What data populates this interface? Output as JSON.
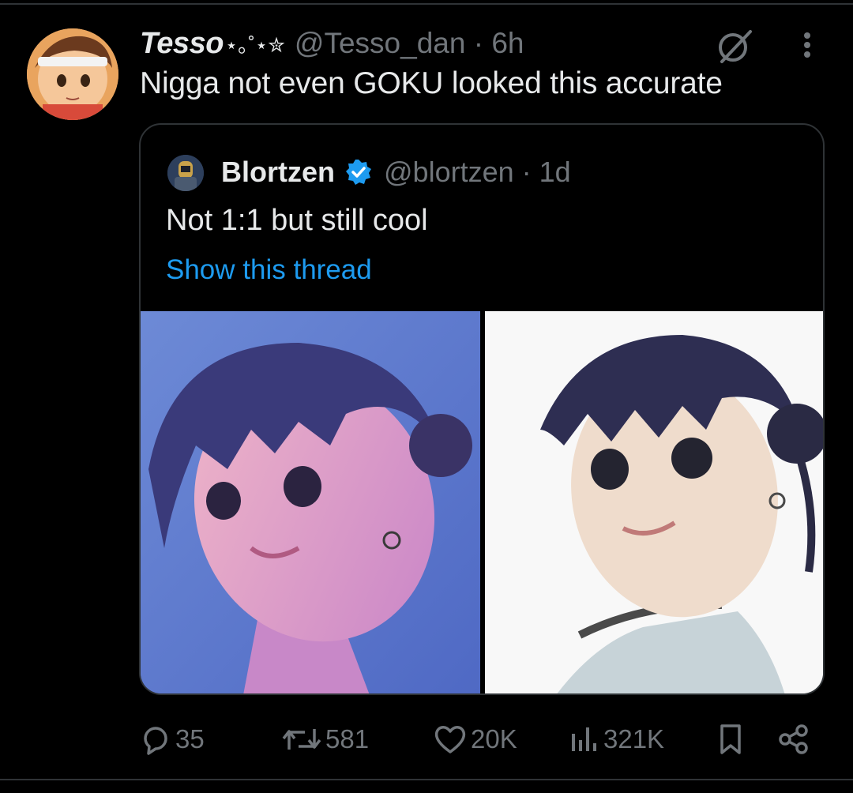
{
  "tweet": {
    "display_name": "Tesso",
    "name_decoration": "⋆｡˚⋆✮",
    "handle_time": "@Tesso_dan · 6h",
    "text": "Nigga not even GOKU looked this accurate"
  },
  "quote": {
    "display_name": "Blortzen",
    "handle_time": "@blortzen · 1d",
    "text": "Not 1:1 but still cool",
    "link": "Show this thread"
  },
  "actions": {
    "replies": "35",
    "reposts": "581",
    "likes": "20K",
    "views": "321K"
  },
  "icons": [
    "grok-icon",
    "more-icon",
    "verified-badge-icon",
    "reply-icon",
    "repost-icon",
    "like-icon",
    "views-icon",
    "bookmark-icon",
    "share-icon"
  ],
  "colors": {
    "background": "#000000",
    "text": "#e7e9ea",
    "muted": "#71767b",
    "link": "#1d9bf0",
    "border": "#2f3336"
  }
}
